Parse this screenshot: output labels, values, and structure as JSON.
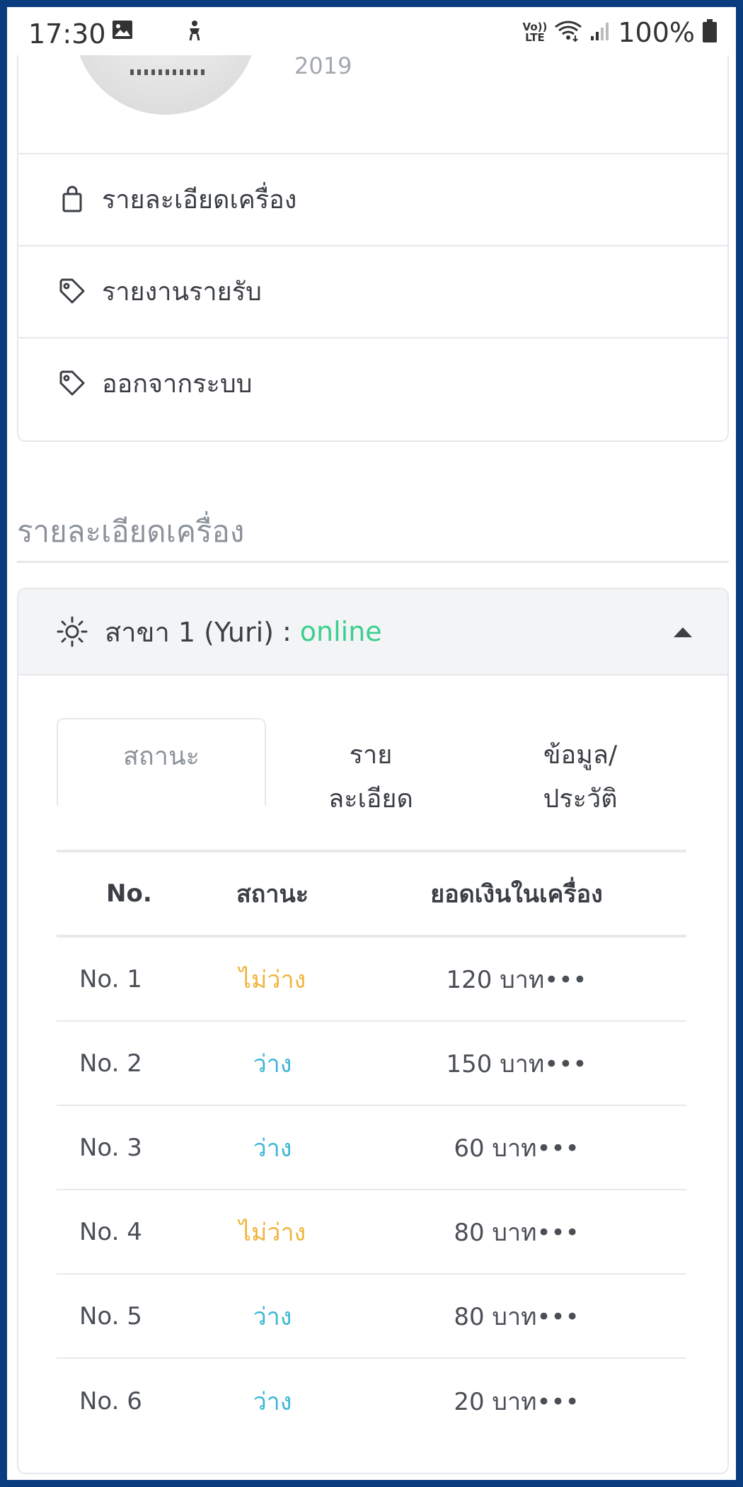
{
  "status_bar": {
    "time": "17:30",
    "volte": [
      "Vo))",
      "LTE"
    ],
    "battery": "100%"
  },
  "profile": {
    "year": "2019",
    "menu": [
      {
        "label": "รายละเอียดเครื่อง",
        "icon": "shopping-bag-icon"
      },
      {
        "label": "รายงานรายรับ",
        "icon": "tag-icon"
      },
      {
        "label": "ออกจากระบบ",
        "icon": "tag-icon"
      }
    ]
  },
  "section_title": "รายละเอียดเครื่อง",
  "machine": {
    "branch": "สาขา 1 (Yuri)",
    "colon": ":",
    "status": "online",
    "tabs": [
      {
        "line1": "สถานะ",
        "line2": ""
      },
      {
        "line1": "ราย",
        "line2": "ละเอียด"
      },
      {
        "line1": "ข้อมูล/",
        "line2": "ประวัติ"
      }
    ],
    "table": {
      "headers": [
        "No.",
        "สถานะ",
        "ยอดเงินในเครื่อง"
      ],
      "rows": [
        {
          "no": "No. 1",
          "status": "ไม่ว่าง",
          "amount": "120 บาท•••"
        },
        {
          "no": "No. 2",
          "status": "ว่าง",
          "amount": "150 บาท•••"
        },
        {
          "no": "No. 3",
          "status": "ว่าง",
          "amount": "60 บาท•••"
        },
        {
          "no": "No. 4",
          "status": "ไม่ว่าง",
          "amount": "80 บาท•••"
        },
        {
          "no": "No. 5",
          "status": "ว่าง",
          "amount": "80 บาท•••"
        },
        {
          "no": "No. 6",
          "status": "ว่าง",
          "amount": "20 บาท•••"
        }
      ]
    }
  },
  "colors": {
    "online": "#3ccf8e",
    "busy": "#f0b43c",
    "free": "#3cb6d6",
    "frame": "#0a3d80"
  }
}
